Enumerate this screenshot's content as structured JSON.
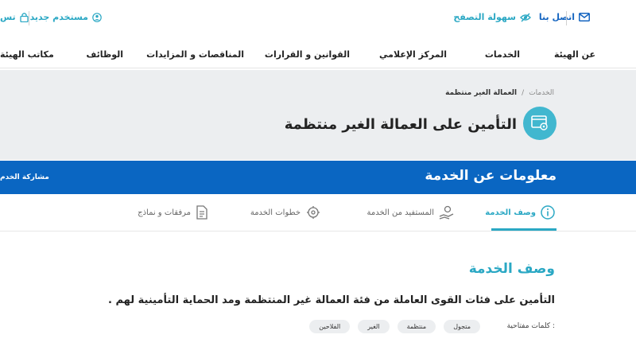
{
  "topbar": {
    "contact": "اتصل بنا",
    "accessibility": "سهولة التصفح",
    "new_user": "مستخدم جديد",
    "login_partial": "تس"
  },
  "nav": {
    "items": [
      "عن الهيئة",
      "الخدمات",
      "المركز الإعلامي",
      "القوانين و القرارات",
      "المناقصات و المزايدات",
      "الوظائف",
      "مكاتب الهيئة"
    ]
  },
  "breadcrumb": {
    "root": "الخدمات",
    "separator": "/",
    "current": "العمالة الغير منتظمة"
  },
  "hero": {
    "title": "التأمين على العمالة الغير منتظمة"
  },
  "section_bar": {
    "title": "معلومات عن الخدمة",
    "share": "مشاركة الخدم"
  },
  "tabs": [
    {
      "label": "وصف الخدمة",
      "icon": "info-icon"
    },
    {
      "label": "المستفيد من الخدمة",
      "icon": "beneficiary-icon"
    },
    {
      "label": "خطوات الخدمة",
      "icon": "steps-icon"
    },
    {
      "label": "مرفقات و نماذج",
      "icon": "document-icon"
    }
  ],
  "content": {
    "title": "وصف الخدمة",
    "description": "التأمين على فئات القوى العاملة من فئة العمالة غير المنتظمة  ومد الحماية التأمينية لهم .",
    "keywords_label": "كلمات مفتاحية :",
    "keywords": [
      "متجول",
      "منتظمة",
      "الغير",
      "الفلاحين"
    ]
  },
  "colors": {
    "primary_blue": "#0a66c2",
    "accent_teal": "#2ba8c4",
    "hero_bg": "#eceef0"
  }
}
